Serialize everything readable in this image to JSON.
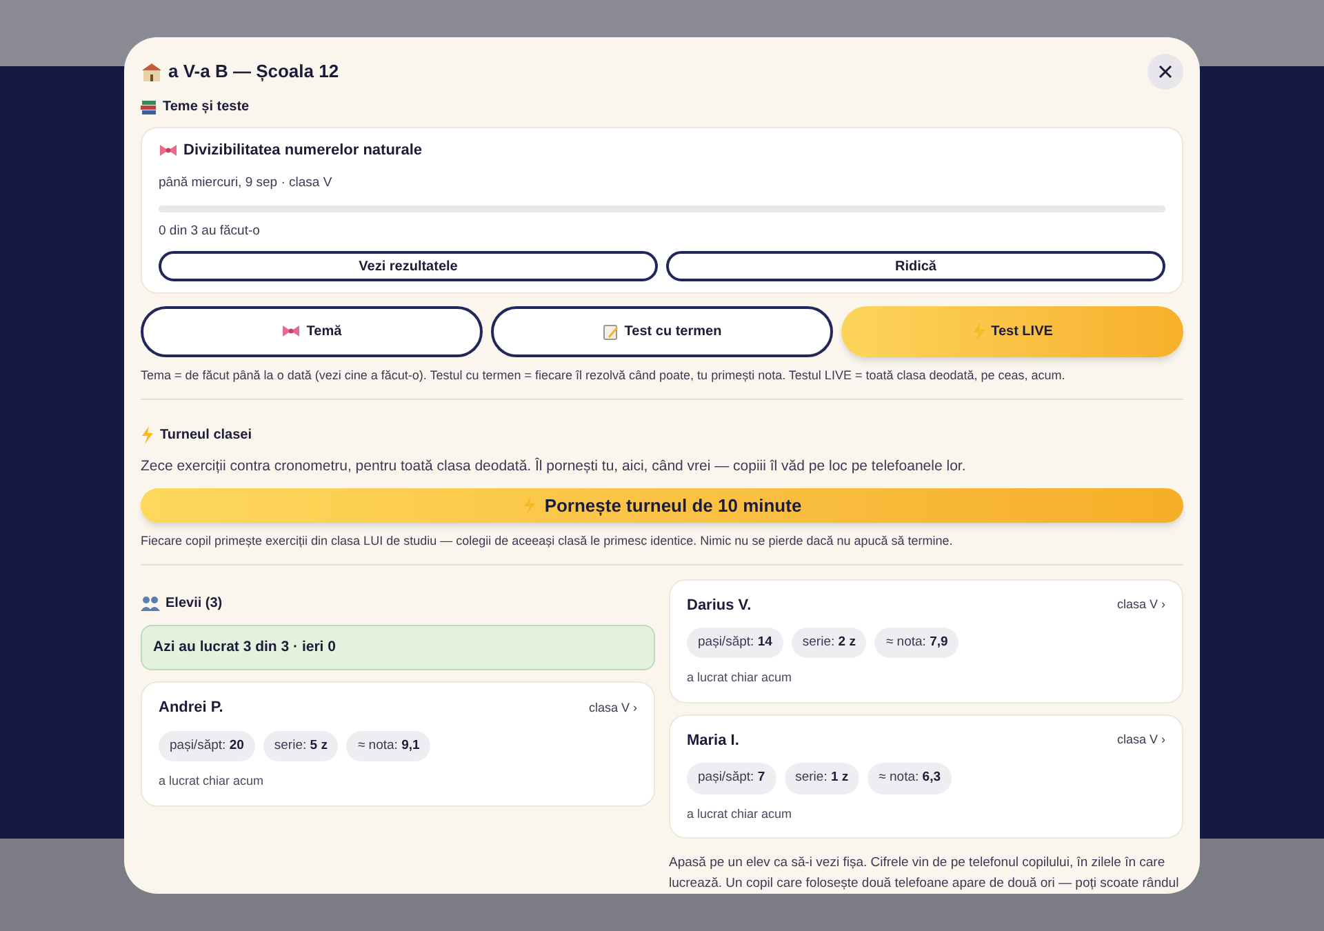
{
  "modal": {
    "title": "a V-a B — Școala 12"
  },
  "homework": {
    "heading": "Teme și teste",
    "assignment": {
      "title": "Divizibilitatea numerelor naturale",
      "meta": "până miercuri, 9 sep · clasa V",
      "level": 0,
      "progress_text": "0 din 3 au făcut-o",
      "buttons": [
        "Vezi rezultatele",
        "Ridică"
      ]
    },
    "tabs": [
      {
        "label": "Temă",
        "kind": "bow",
        "selected": false
      },
      {
        "label": "Test cu termen",
        "kind": "memo",
        "selected": false
      },
      {
        "label": "Test LIVE",
        "kind": "bolt",
        "selected": true
      }
    ],
    "note": "Tema = de făcut până la o dată (vezi cine a făcut-o). Testul cu termen = fiecare îl rezolvă când poate, tu primești nota. Testul LIVE = toată clasa deodată, pe ceas, acum."
  },
  "tournament": {
    "heading": "Turneul clasei",
    "description": "Zece exerciții contra cronometru, pentru toată clasa deodată. Îl pornești tu, aici, când vrei — copiii îl văd pe loc pe telefoanele lor.",
    "button": "Pornește turneul de 10 minute",
    "note": "Fiecare copil primește exerciții din clasa LUI de studiu — colegii de aceeași clasă le primesc identice. Nimic nu se pierde dacă nu apucă să termine."
  },
  "students": {
    "heading": "Elevii (3)",
    "summary": "Azi au lucrat 3 din 3 · ieri 0",
    "items": [
      {
        "name": "Andrei P.",
        "class_link": "clasa V ›",
        "stats": [
          {
            "label": "pași/săpt:",
            "value": "20"
          },
          {
            "label": "serie:",
            "value": "5 z"
          },
          {
            "label": "≈ nota:",
            "value": "9,1"
          }
        ],
        "last_active": "a lucrat chiar acum"
      },
      {
        "name": "Darius V.",
        "class_link": "clasa V ›",
        "stats": [
          {
            "label": "pași/săpt:",
            "value": "14"
          },
          {
            "label": "serie:",
            "value": "2 z"
          },
          {
            "label": "≈ nota:",
            "value": "7,9"
          }
        ],
        "last_active": "a lucrat chiar acum"
      },
      {
        "name": "Maria I.",
        "class_link": "clasa V ›",
        "stats": [
          {
            "label": "pași/săpt:",
            "value": "7"
          },
          {
            "label": "serie:",
            "value": "1 z"
          },
          {
            "label": "≈ nota:",
            "value": "6,3"
          }
        ],
        "last_active": "a lucrat chiar acum"
      }
    ],
    "note": "Apasă pe un elev ca să-i vezi fișa. Cifrele vin de pe telefonul copilului, în zilele în care lucrează. Un copil care folosește două telefoane apare de două ori — poți scoate rândul"
  }
}
